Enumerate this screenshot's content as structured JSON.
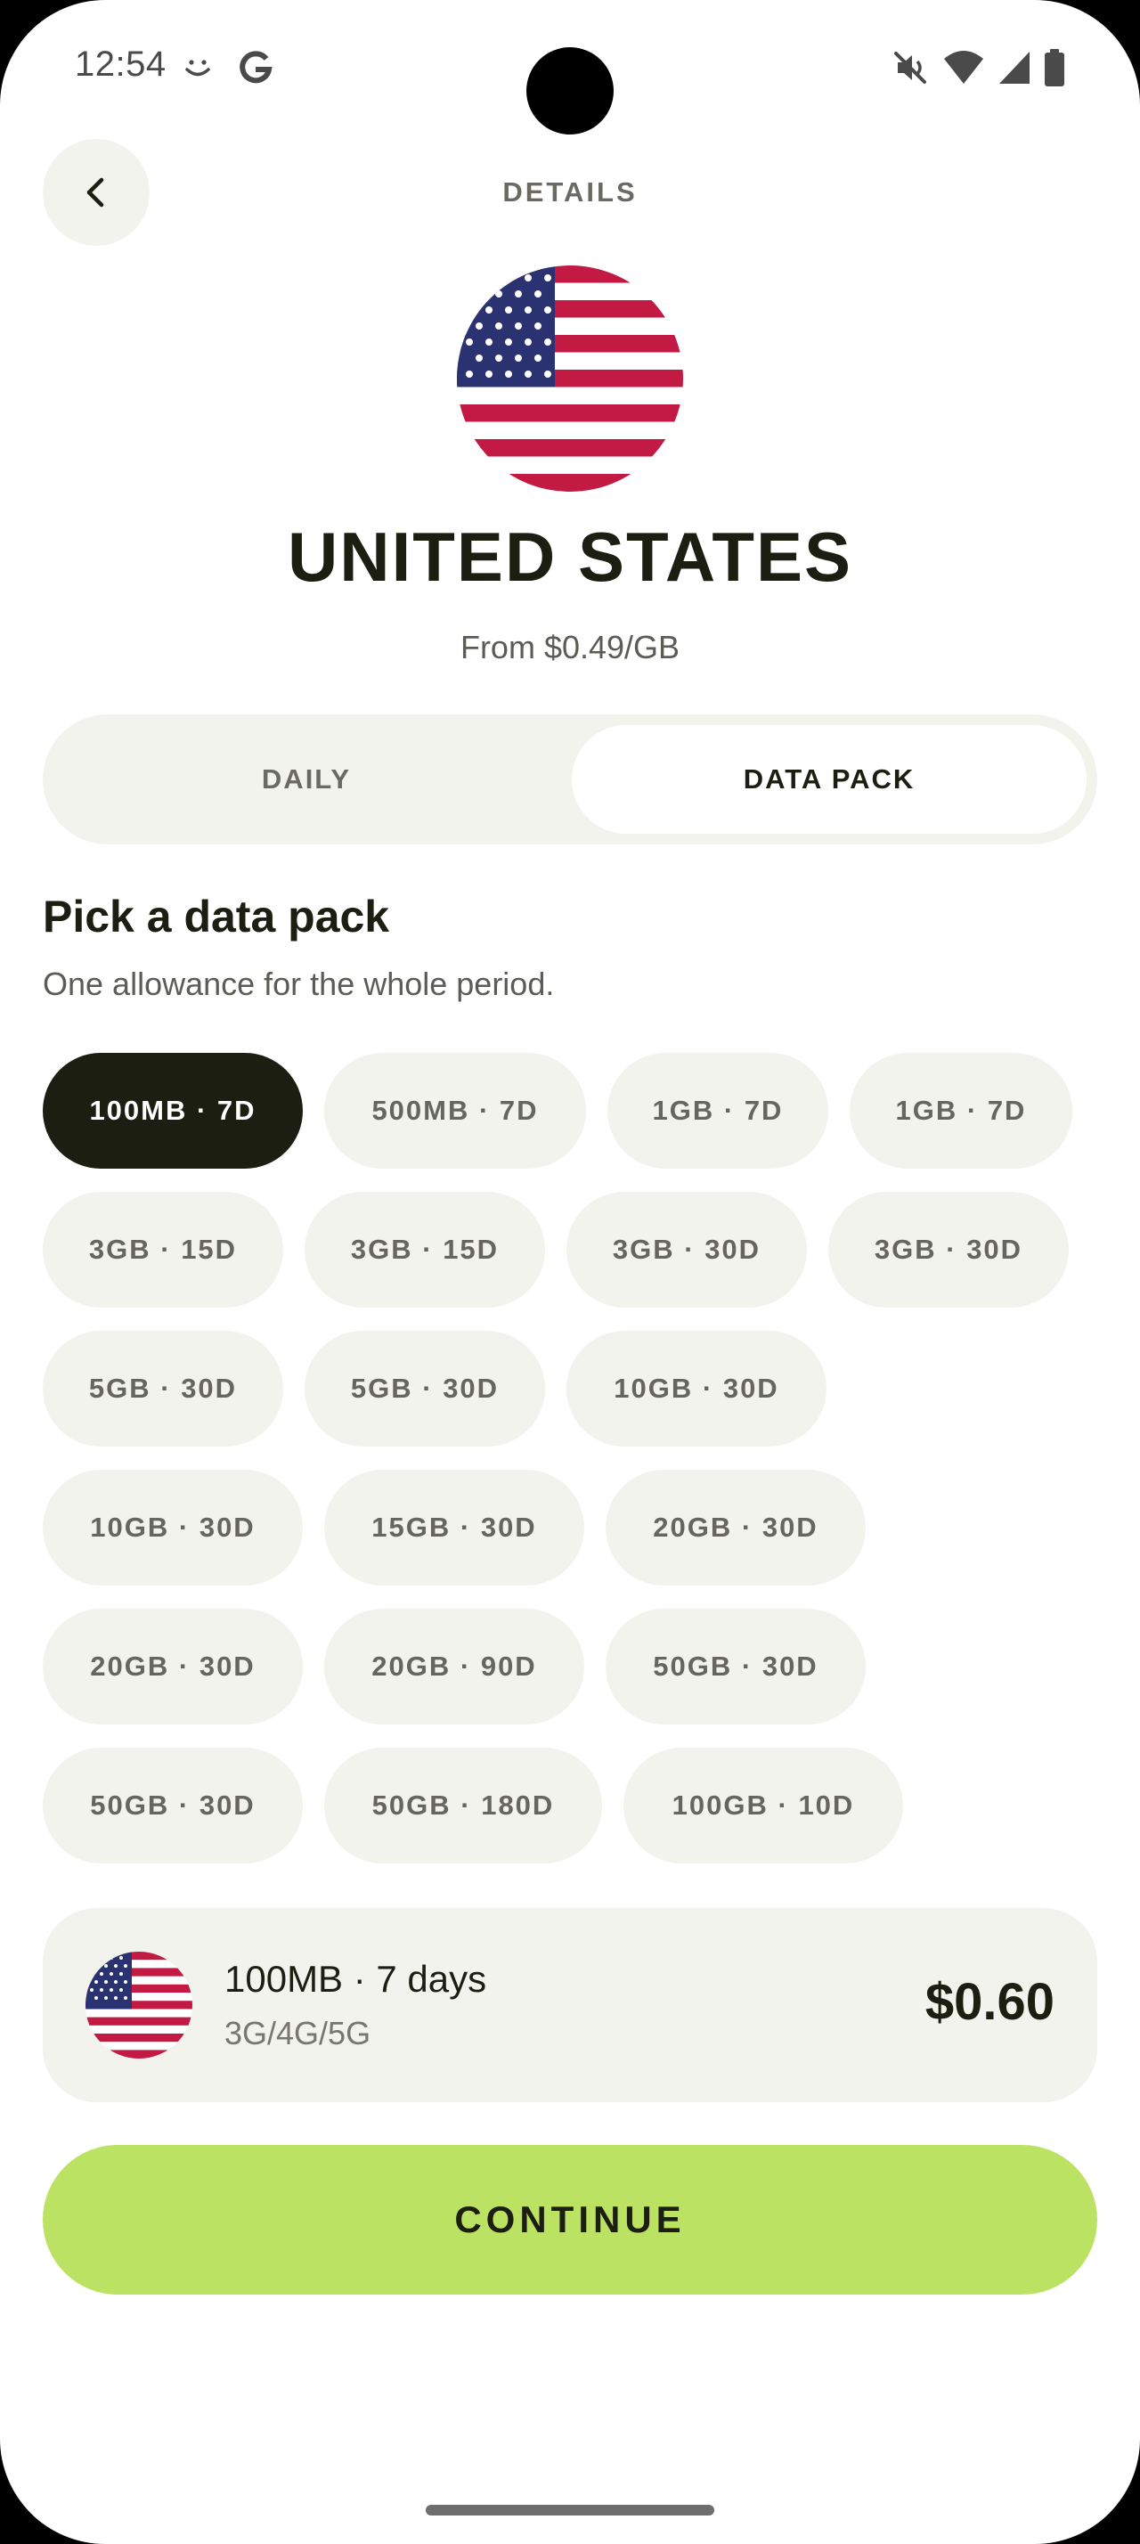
{
  "status_bar": {
    "time": "12:54",
    "icons": [
      "face-icon",
      "google-icon",
      "mute-icon",
      "wifi-icon",
      "signal-icon",
      "battery-icon"
    ]
  },
  "header": {
    "back_icon": "chevron-left-icon",
    "title": "DETAILS"
  },
  "country": {
    "name": "UNITED STATES",
    "from_price": "From $0.49/GB",
    "flag_icon": "us-flag"
  },
  "tabs": [
    {
      "label": "DAILY",
      "selected": false
    },
    {
      "label": "DATA PACK",
      "selected": true
    }
  ],
  "pack_section": {
    "title": "Pick a data pack",
    "subtitle": "One allowance for the whole period."
  },
  "packs": [
    [
      "100MB · 7D",
      "500MB · 7D",
      "1GB · 7D",
      "1GB · 7D"
    ],
    [
      "3GB · 15D",
      "3GB · 15D",
      "3GB · 30D",
      "3GB · 30D"
    ],
    [
      "5GB · 30D",
      "5GB · 30D",
      "10GB · 30D"
    ],
    [
      "10GB · 30D",
      "15GB · 30D",
      "20GB · 30D"
    ],
    [
      "20GB · 30D",
      "20GB · 90D",
      "50GB · 30D"
    ],
    [
      "50GB · 30D",
      "50GB · 180D",
      "100GB · 10D"
    ]
  ],
  "selected_pack": "100MB · 7D",
  "summary": {
    "title": "100MB · 7 days",
    "network": "3G/4G/5G",
    "price": "$0.60"
  },
  "continue_label": "CONTINUE",
  "colors": {
    "dark": "#1c1e12",
    "chip_bg": "#f3f3ee",
    "accent": "#bce263"
  }
}
